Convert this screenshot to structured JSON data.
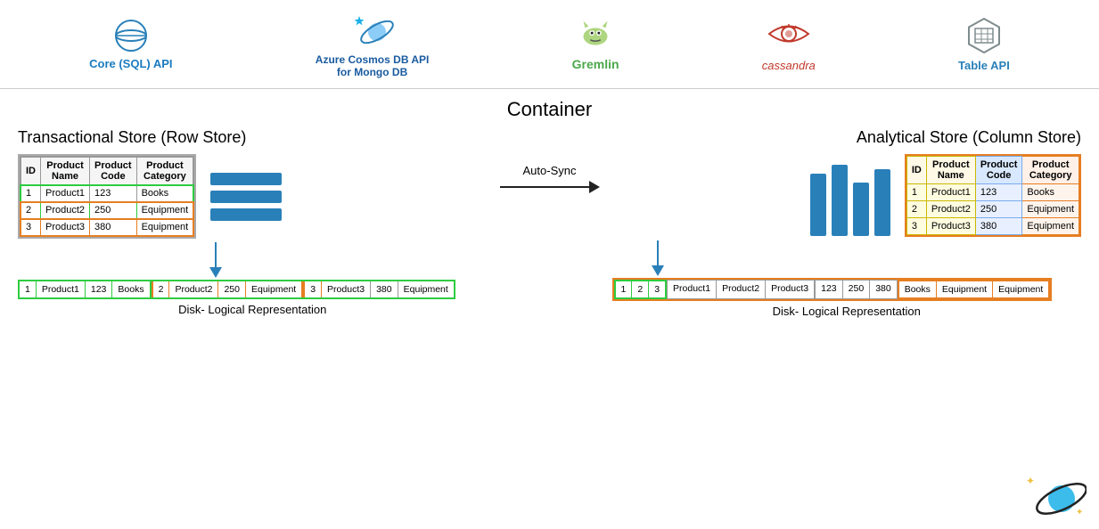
{
  "nav": {
    "items": [
      {
        "label": "Core (SQL) API",
        "sublabel": "",
        "color": "blue"
      },
      {
        "label": "Azure Cosmos DB API",
        "sublabel": "for Mongo DB",
        "color": "dark-blue"
      },
      {
        "label": "Gremlin",
        "sublabel": "",
        "color": "green"
      },
      {
        "label": "cassandra",
        "sublabel": "",
        "color": "orange"
      },
      {
        "label": "Table API",
        "sublabel": "",
        "color": "gray-blue"
      }
    ]
  },
  "main": {
    "container_title": "Container",
    "left_store_title": "Transactional Store (Row Store)",
    "right_store_title": "Analytical Store (Column Store)",
    "auto_sync_label": "Auto-Sync",
    "left_disk_label": "Disk- Logical Representation",
    "right_disk_label": "Disk- Logical Representation"
  },
  "row_table": {
    "headers": [
      "ID",
      "Product\nName",
      "Product\nCode",
      "Product\nCategory"
    ],
    "rows": [
      [
        "1",
        "Product1",
        "123",
        "Books"
      ],
      [
        "2",
        "Product2",
        "250",
        "Equipment"
      ],
      [
        "3",
        "Product3",
        "380",
        "Equipment"
      ]
    ]
  },
  "col_table": {
    "headers": [
      "ID",
      "Product\nName",
      "Product\nCode",
      "Product\nCategory"
    ],
    "rows": [
      [
        "1",
        "Product1",
        "123",
        "Books"
      ],
      [
        "2",
        "Product2",
        "250",
        "Equipment"
      ],
      [
        "3",
        "Product3",
        "380",
        "Equipment"
      ]
    ]
  },
  "left_disk_cells": [
    "1",
    "Product1",
    "123",
    "Books",
    "2",
    "Product2",
    "250",
    "Equipment",
    "3",
    "Product3",
    "380",
    "Equipment"
  ],
  "right_disk_cells_col1": [
    "1",
    "2",
    "3"
  ],
  "right_disk_cells_col2": [
    "Product1",
    "Product2",
    "Product3"
  ],
  "right_disk_cells_col3": [
    "123",
    "250",
    "380"
  ],
  "right_disk_cells_col4": [
    "Books",
    "Equipment",
    "Equipment"
  ]
}
